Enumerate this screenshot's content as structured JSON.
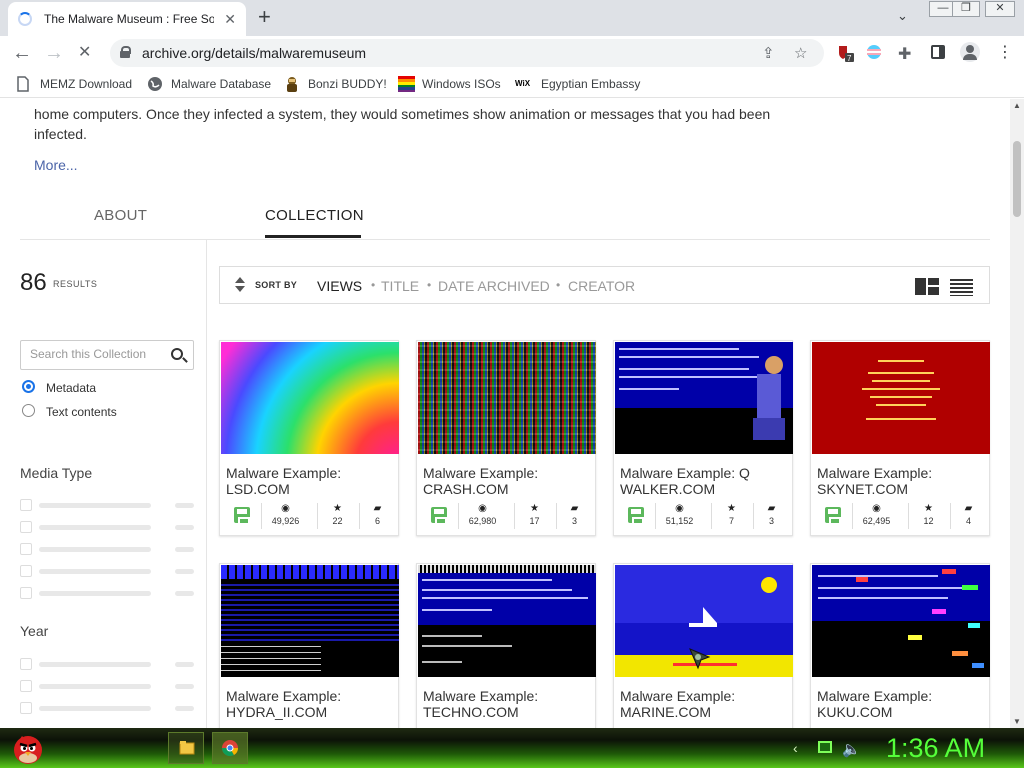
{
  "browser": {
    "tab": {
      "title": "The Malware Museum : Free Software"
    },
    "url": "archive.org/details/malwaremuseum",
    "extension_badge": "7",
    "bookmarks": [
      {
        "label": "MEMZ Download",
        "icon": "page-icon"
      },
      {
        "label": "Malware Database",
        "icon": "globe-icon"
      },
      {
        "label": "Bonzi BUDDY!",
        "icon": "bonzi-icon"
      },
      {
        "label": "Windows ISOs",
        "icon": "windows-flag-icon"
      },
      {
        "label": "Egyptian Embassy",
        "icon": "wix-icon"
      }
    ],
    "wix_glyph": "WiX"
  },
  "page": {
    "description": "home computers. Once they infected a system, they would sometimes show animation or messages that you had been infected.",
    "more_link": "More...",
    "tabs": {
      "about": "ABOUT",
      "collection": "COLLECTION"
    },
    "results": {
      "count": "86",
      "label": "RESULTS"
    },
    "search": {
      "placeholder": "Search this Collection"
    },
    "search_options": {
      "metadata": "Metadata",
      "text_contents": "Text contents"
    },
    "facets": {
      "media_type": "Media Type",
      "year": "Year"
    },
    "sort": {
      "label": "SORT BY",
      "options": [
        "VIEWS",
        "TITLE",
        "DATE ARCHIVED",
        "CREATOR"
      ],
      "separator": "•"
    },
    "items": [
      {
        "title": "Malware Example: LSD.COM",
        "views": "49,926",
        "favorites": "22",
        "reviews": "6"
      },
      {
        "title": "Malware Example: CRASH.COM",
        "views": "62,980",
        "favorites": "17",
        "reviews": "3"
      },
      {
        "title": "Malware Example: Q WALKER.COM",
        "views": "51,152",
        "favorites": "7",
        "reviews": "3"
      },
      {
        "title": "Malware Example: SKYNET.COM",
        "views": "62,495",
        "favorites": "12",
        "reviews": "4"
      },
      {
        "title": "Malware Example: HYDRA_II.COM"
      },
      {
        "title": "Malware Example: TECHNO.COM"
      },
      {
        "title": "Malware Example: MARINE.COM"
      },
      {
        "title": "Malware Example: KUKU.COM"
      }
    ]
  },
  "taskbar": {
    "clock": "1:36 AM"
  },
  "colors": {
    "link": "#4b64a8",
    "clock": "#55ff3a",
    "accent": "#1a73e8"
  }
}
